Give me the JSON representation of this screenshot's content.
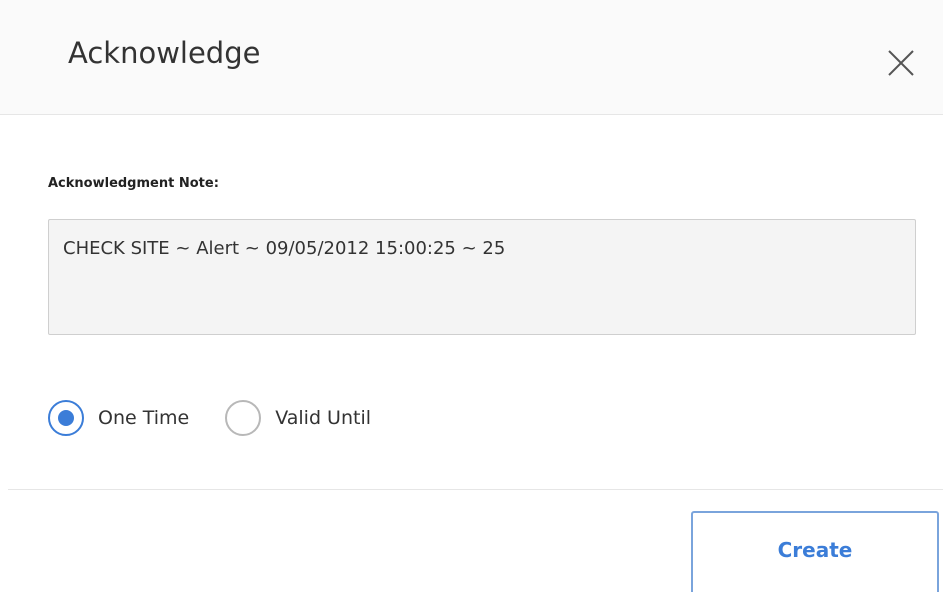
{
  "dialog": {
    "title": "Acknowledge",
    "close_icon": "close-icon"
  },
  "note": {
    "label": "Acknowledgment Note:",
    "value": "CHECK SITE ~ Alert ~ 09/05/2012 15:00:25 ~ 25"
  },
  "options": [
    {
      "label": "One Time",
      "checked": true
    },
    {
      "label": "Valid Until",
      "checked": false
    }
  ],
  "footer": {
    "create_label": "Create"
  },
  "colors": {
    "accent": "#3b7dd8",
    "header_bg": "#fafafa",
    "textbox_bg": "#f4f4f4"
  }
}
